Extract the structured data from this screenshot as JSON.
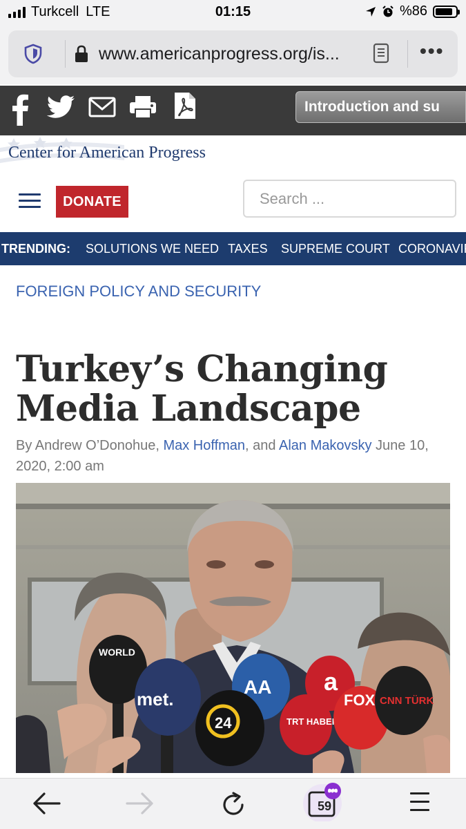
{
  "status_bar": {
    "carrier": "Turkcell",
    "network": "LTE",
    "time": "01:15",
    "battery_text": "%86",
    "battery_level": 0.86
  },
  "browser": {
    "url": "www.americanprogress.org/is...",
    "icons": [
      "shield-icon",
      "lock-icon",
      "reader-view-icon",
      "more-options-icon"
    ]
  },
  "share_bar": {
    "icons": [
      "facebook-icon",
      "twitter-icon",
      "email-icon",
      "print-icon",
      "pdf-icon"
    ],
    "toc_button": "Introduction and su"
  },
  "site": {
    "logo_text": "Center for American Progress",
    "donate_label": "DONATE",
    "search_placeholder": "Search ...",
    "brand_blue": "#1d3c6e",
    "brand_red": "#c0262c"
  },
  "trending": {
    "label": "TRENDING:",
    "items": [
      "SOLUTIONS WE NEED",
      "TAXES",
      "SUPREME COURT",
      "CORONAVIRUS"
    ]
  },
  "article": {
    "category": "FOREIGN POLICY AND SECURITY",
    "title_line1": "Turkey’s Changing",
    "title_line2": "Media Landscape",
    "byline_prefix": "By Andrew O’Donohue, ",
    "author2": "Max Hoffman",
    "byline_and": ", and ",
    "author3": "Alan Makovsky",
    "date": " June 10, 2020, 2:00 am",
    "photo_mic_labels": [
      "WORLD",
      "met.",
      "AA",
      "24",
      "a",
      "TRT HABER",
      "FOX",
      "CNN TÜRK"
    ]
  },
  "bottom_bar": {
    "tab_count": "59",
    "icons": [
      "back-arrow-icon",
      "forward-arrow-icon",
      "reload-icon",
      "tabs-icon",
      "menu-icon"
    ]
  }
}
